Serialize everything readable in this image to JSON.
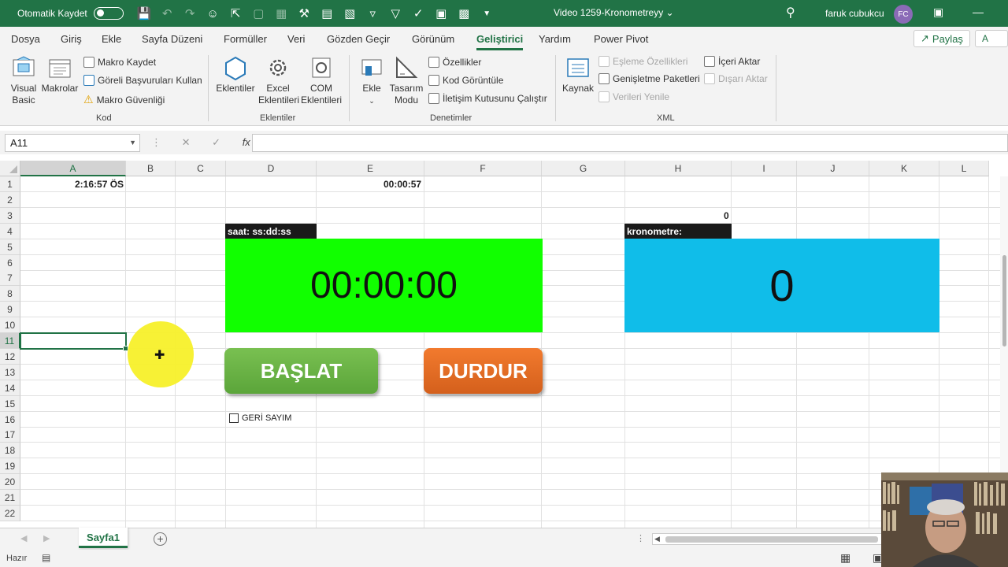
{
  "titlebar": {
    "autosave_label": "Otomatik Kaydet",
    "doc_title": "Video 1259-Kronometreyy ⌄",
    "user_name": "faruk cubukcu",
    "user_initials": "FC"
  },
  "tabs": [
    "Dosya",
    "Giriş",
    "Ekle",
    "Sayfa Düzeni",
    "Formüller",
    "Veri",
    "Gözden Geçir",
    "Görünüm",
    "Geliştirici",
    "Yardım",
    "Power Pivot"
  ],
  "active_tab": "Geliştirici",
  "share_label": "Paylaş",
  "share2_label": "A",
  "ribbon": {
    "kod": {
      "group_label": "Kod",
      "visual_basic": [
        "Visual",
        "Basic"
      ],
      "makrolar": "Makrolar",
      "makro_kaydet": "Makro Kaydet",
      "goreli": "Göreli Başvuruları Kullan",
      "makro_guvenligi": "Makro Güvenliği"
    },
    "eklentiler": {
      "group_label": "Eklentiler",
      "eklentiler": "Eklentiler",
      "excel_eklentileri": [
        "Excel",
        "Eklentileri"
      ],
      "com_eklentileri": [
        "COM",
        "Eklentileri"
      ]
    },
    "denetimler": {
      "group_label": "Denetimler",
      "ekle": "Ekle",
      "tasarim_modu": [
        "Tasarım",
        "Modu"
      ],
      "ozellikler": "Özellikler",
      "kod_goruntule": "Kod Görüntüle",
      "iletisim": "İletişim Kutusunu Çalıştır"
    },
    "xml": {
      "group_label": "XML",
      "kaynak": "Kaynak",
      "esleme": "Eşleme Özellikleri",
      "genisletme": "Genişletme Paketleri",
      "verileri_yenile": "Verileri Yenile",
      "iceri_aktar": "İçeri Aktar",
      "disari_aktar": "Dışarı Aktar"
    }
  },
  "formula_bar": {
    "name_box": "A11",
    "formula": ""
  },
  "columns": [
    "A",
    "B",
    "C",
    "D",
    "E",
    "F",
    "G",
    "H",
    "I",
    "J",
    "K",
    "L"
  ],
  "rows": [
    "1",
    "2",
    "3",
    "4",
    "5",
    "6",
    "7",
    "8",
    "9",
    "10",
    "11",
    "12",
    "13",
    "14",
    "15",
    "16",
    "17",
    "18",
    "19",
    "20",
    "21",
    "22"
  ],
  "cells": {
    "A1": "2:16:57 ÖS",
    "E1": "00:00:57",
    "H3": "0"
  },
  "clock": {
    "label": "saat: ss:dd:ss",
    "value": "00:00:00",
    "color": "#11ff00"
  },
  "stopwatch": {
    "label": "kronometre:",
    "value": "0",
    "color": "#10bde9"
  },
  "buttons": {
    "start": "BAŞLAT",
    "stop": "DURDUR"
  },
  "checkbox": {
    "label": "GERİ SAYIM",
    "checked": false
  },
  "sheets": [
    "Sayfa1"
  ],
  "status": "Hazır"
}
